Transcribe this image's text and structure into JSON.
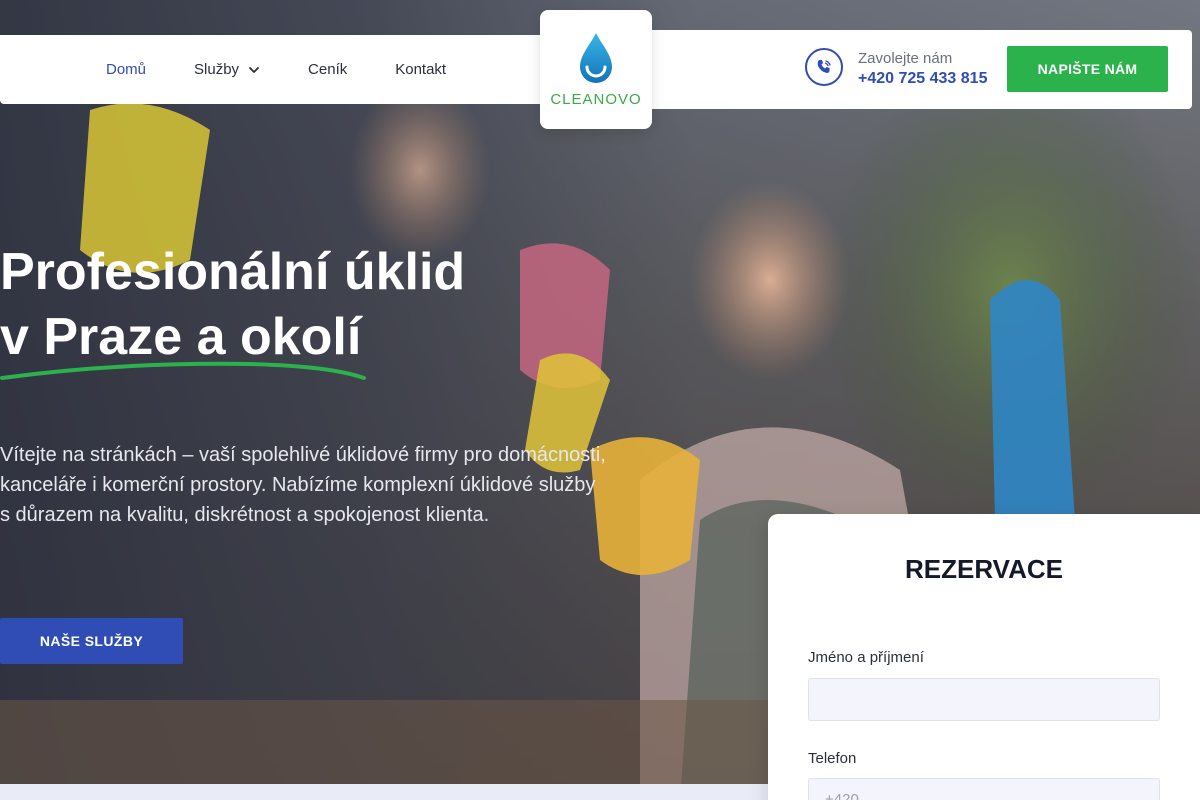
{
  "nav": {
    "items": [
      {
        "label": "Domů",
        "active": true
      },
      {
        "label": "Služby",
        "active": false,
        "has_dropdown": true
      },
      {
        "label": "Ceník",
        "active": false
      },
      {
        "label": "Kontakt",
        "active": false
      }
    ]
  },
  "logo": {
    "text": "CLEANOVO"
  },
  "contact": {
    "call_label": "Zavolejte nám",
    "phone": "+420 725 433 815",
    "cta_label": "NAPIŠTE NÁM"
  },
  "hero": {
    "title_line1": "Profesionální úklid",
    "title_line2": "v Praze a okolí",
    "text": "Vítejte na stránkách – vaší spolehlivé úklidové firmy pro domácnosti, kanceláře i komerční prostory. Nabízíme komplexní úklidové služby s důrazem na kvalitu, diskrétnost a spokojenost klienta.",
    "button_label": "NAŠE SLUŽBY"
  },
  "reservation": {
    "title": "REZERVACE",
    "name_label": "Jméno a příjmení",
    "name_value": "",
    "phone_label": "Telefon",
    "phone_placeholder": "+420"
  },
  "colors": {
    "brand_blue": "#2f4db5",
    "brand_green": "#2bb24c",
    "logo_drop": "#1e9ad6"
  }
}
